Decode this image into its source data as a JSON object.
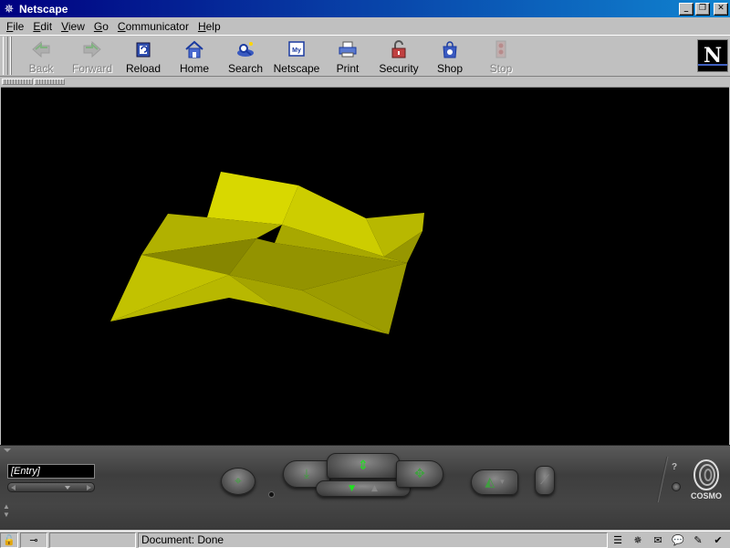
{
  "window": {
    "title": "Netscape"
  },
  "menu": [
    "File",
    "Edit",
    "View",
    "Go",
    "Communicator",
    "Help"
  ],
  "menu_mnemonics": [
    "F",
    "E",
    "V",
    "G",
    "C",
    "H"
  ],
  "toolbar": {
    "buttons": [
      {
        "label": "Back",
        "icon": "back-arrow-icon",
        "enabled": false
      },
      {
        "label": "Forward",
        "icon": "forward-arrow-icon",
        "enabled": false
      },
      {
        "label": "Reload",
        "icon": "reload-icon",
        "enabled": true
      },
      {
        "label": "Home",
        "icon": "home-icon",
        "enabled": true
      },
      {
        "label": "Search",
        "icon": "search-icon",
        "enabled": true
      },
      {
        "label": "Netscape",
        "icon": "my-netscape-icon",
        "enabled": true
      },
      {
        "label": "Print",
        "icon": "printer-icon",
        "enabled": true
      },
      {
        "label": "Security",
        "icon": "padlock-icon",
        "enabled": true
      },
      {
        "label": "Shop",
        "icon": "shopping-bag-icon",
        "enabled": true
      },
      {
        "label": "Stop",
        "icon": "stop-icon",
        "enabled": false
      }
    ],
    "logo_letter": "N"
  },
  "viewer": {
    "background": "#000000",
    "model_color": "#d8d800"
  },
  "dashboard": {
    "entry_viewpoint": "[Entry]",
    "brand": "COSMO",
    "help": "?"
  },
  "status": {
    "text": "Document: Done"
  },
  "colors": {
    "title_start": "#000080",
    "title_end": "#1084d0",
    "chrome": "#c0c0c0",
    "dash_green": "#3fa03f"
  }
}
